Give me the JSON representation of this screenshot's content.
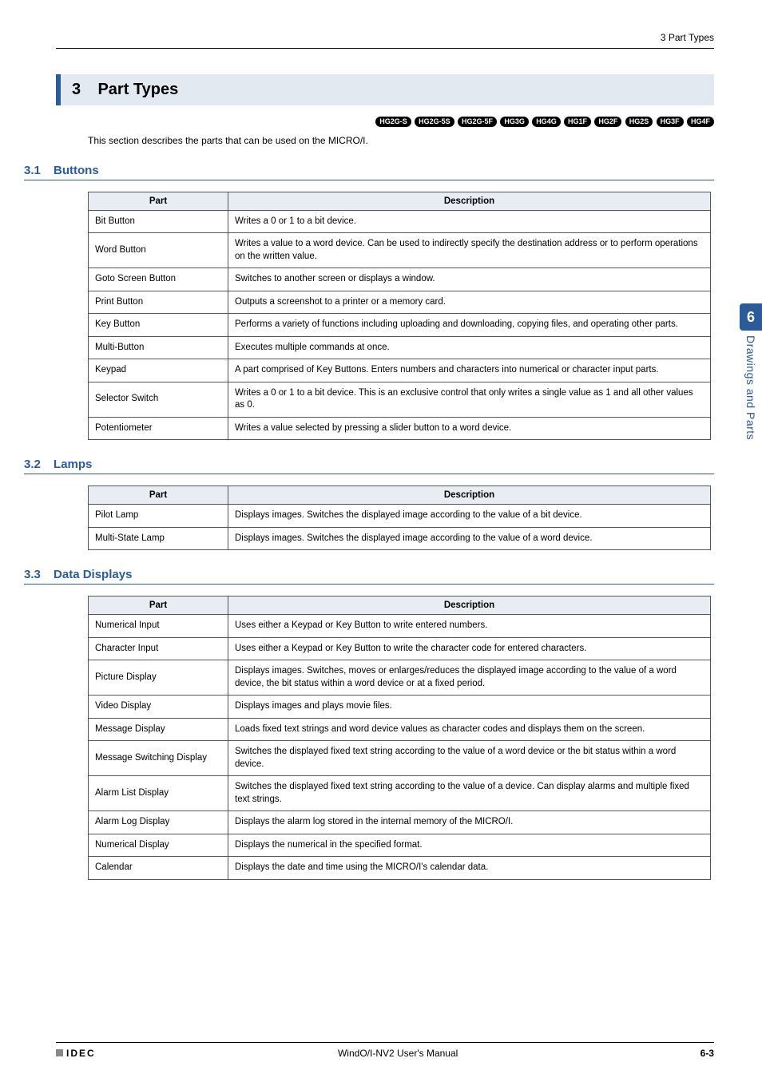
{
  "header": {
    "breadcrumb": "3 Part Types"
  },
  "section": {
    "num": "3",
    "title": "Part Types"
  },
  "badges": [
    "HG2G-S",
    "HG2G-5S",
    "HG2G-5F",
    "HG3G",
    "HG4G",
    "HG1F",
    "HG2F",
    "HG2S",
    "HG3F",
    "HG4F"
  ],
  "intro": "This section describes the parts that can be used on the MICRO/I.",
  "tables": {
    "buttons": {
      "num": "3.1",
      "title": "Buttons",
      "headers": [
        "Part",
        "Description"
      ],
      "rows": [
        [
          "Bit Button",
          "Writes a 0 or 1 to a bit device."
        ],
        [
          "Word Button",
          "Writes a value to a word device. Can be used to indirectly specify the destination address or to perform operations on the written value."
        ],
        [
          "Goto Screen Button",
          "Switches to another screen or displays a window."
        ],
        [
          "Print Button",
          "Outputs a screenshot to a printer or a memory card."
        ],
        [
          "Key Button",
          "Performs a variety of functions including uploading and downloading, copying files, and operating other parts."
        ],
        [
          "Multi-Button",
          "Executes multiple commands at once."
        ],
        [
          "Keypad",
          "A part comprised of Key Buttons. Enters numbers and characters into numerical or character input parts."
        ],
        [
          "Selector Switch",
          "Writes a 0 or 1 to a bit device. This is an exclusive control that only writes a single value as 1 and all other values as 0."
        ],
        [
          "Potentiometer",
          "Writes a value selected by pressing a slider button to a word device."
        ]
      ]
    },
    "lamps": {
      "num": "3.2",
      "title": "Lamps",
      "headers": [
        "Part",
        "Description"
      ],
      "rows": [
        [
          "Pilot Lamp",
          "Displays images. Switches the displayed image according to the value of a bit device."
        ],
        [
          "Multi-State Lamp",
          "Displays images. Switches the displayed image according to the value of a word device."
        ]
      ]
    },
    "datadisplays": {
      "num": "3.3",
      "title": "Data Displays",
      "headers": [
        "Part",
        "Description"
      ],
      "rows": [
        [
          "Numerical Input",
          "Uses either a Keypad or Key Button to write entered numbers."
        ],
        [
          "Character Input",
          "Uses either a Keypad or Key Button to write the character code for entered characters."
        ],
        [
          "Picture Display",
          "Displays images. Switches, moves or enlarges/reduces the displayed image according to the value of a word device, the bit status within a word device or at a fixed period."
        ],
        [
          "Video Display",
          "Displays images and plays movie files."
        ],
        [
          "Message Display",
          "Loads fixed text strings and word device values as character codes and displays them on the screen."
        ],
        [
          "Message Switching Display",
          "Switches the displayed fixed text string according to the value of a word device or the bit status within a word device."
        ],
        [
          "Alarm List Display",
          "Switches the displayed fixed text string according to the value of a device. Can display alarms and multiple fixed text strings."
        ],
        [
          "Alarm Log Display",
          "Displays the alarm log stored in the internal memory of the MICRO/I."
        ],
        [
          "Numerical Display",
          "Displays the numerical in the specified format."
        ],
        [
          "Calendar",
          "Displays the date and time using the MICRO/I's calendar data."
        ]
      ]
    }
  },
  "side": {
    "chapter": "6",
    "label": "Drawings and Parts"
  },
  "footer": {
    "logo": "IDEC",
    "center": "WindO/I-NV2 User's Manual",
    "page": "6-3"
  }
}
